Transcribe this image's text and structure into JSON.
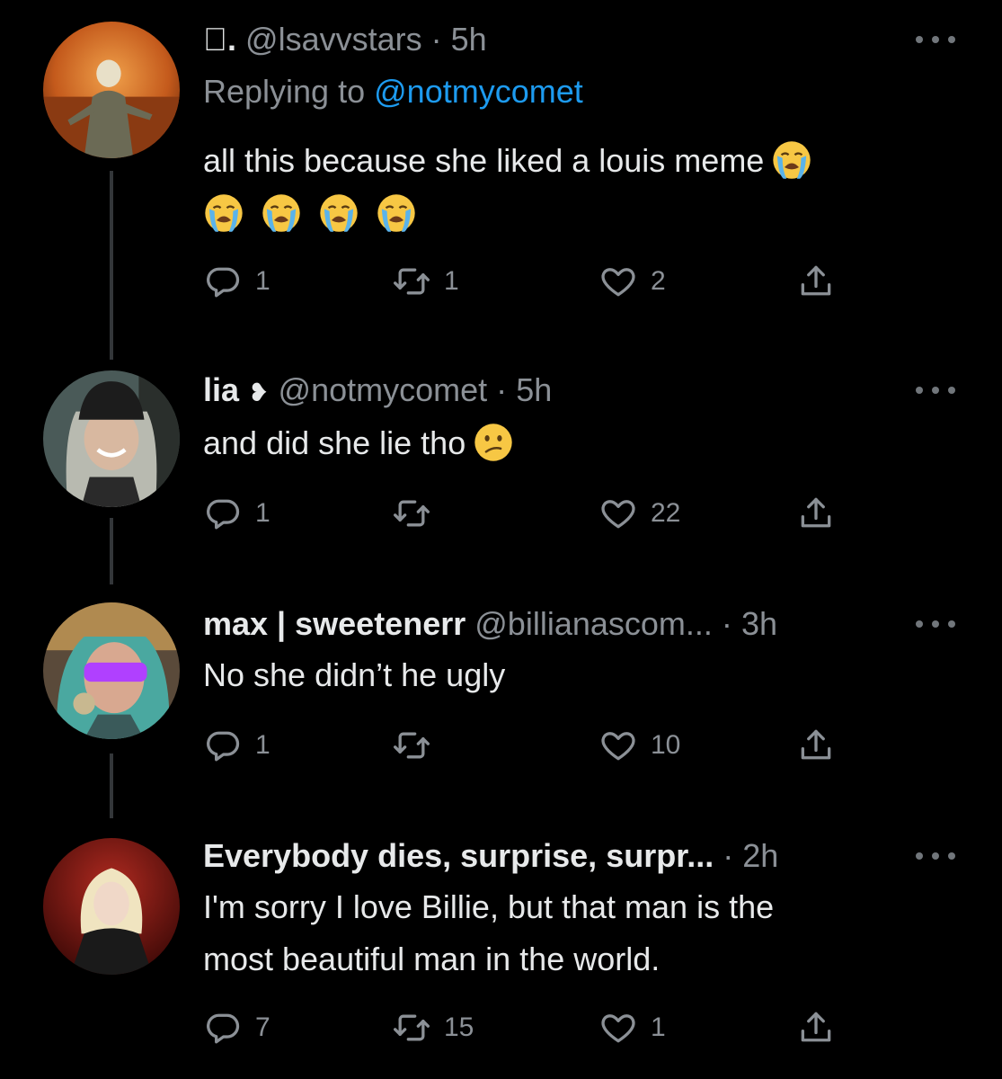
{
  "tweets": [
    {
      "name_mark": "\u0001f34e.",
      "name_text": "",
      "handle": "@lsavvstars",
      "dot": "·",
      "time": "5h",
      "replying_label": "Replying to",
      "replying_handle": "@notmycomet",
      "text": "all this because she liked a louis meme",
      "emoji": "loudly-crying-face",
      "reply_count": "1",
      "retweet_count": "1",
      "like_count": "2"
    },
    {
      "name": "lia",
      "badge": "heart-exclamation-icon",
      "handle": "@notmycomet",
      "dot": "·",
      "time": "5h",
      "text": "and did she lie tho",
      "emoji": "confused-face",
      "reply_count": "1",
      "retweet_count": "",
      "like_count": "22"
    },
    {
      "name": "max | sweetenerr",
      "handle": "@billianascom...",
      "dot": "·",
      "time": "3h",
      "text": "No she didn’t he ugly",
      "reply_count": "1",
      "retweet_count": "",
      "like_count": "10"
    },
    {
      "name": "Everybody dies, surprise, surpr...",
      "handle": "",
      "dot": "·",
      "time": "2h",
      "text_line1": "I'm sorry I love Billie, but that man is the",
      "text_line2": "most beautiful man in the world.",
      "reply_count": "7",
      "retweet_count": "15",
      "like_count": "1"
    }
  ],
  "icons": {
    "reply": "reply-icon",
    "retweet": "retweet-icon",
    "like": "heart-icon",
    "share": "share-icon",
    "more": "more-dots-icon"
  },
  "colors": {
    "background": "#000000",
    "text": "#e7e9ea",
    "secondary": "#8b9096",
    "link": "#1d9bf0"
  }
}
